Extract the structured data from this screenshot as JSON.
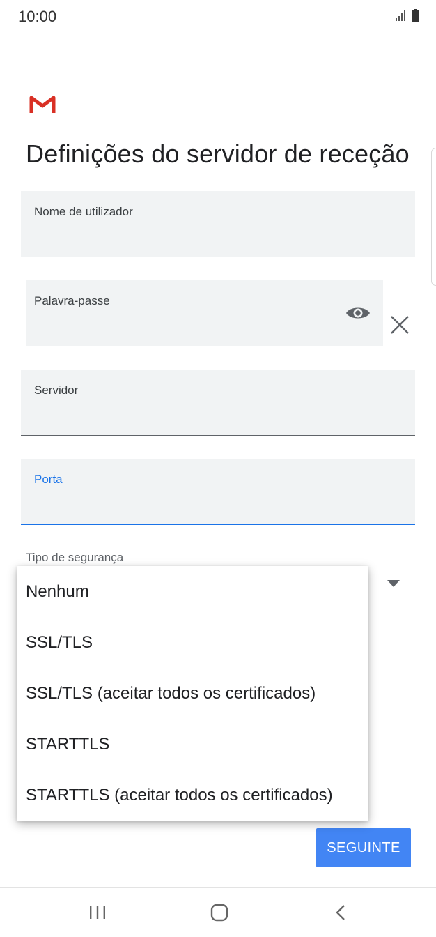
{
  "status_bar": {
    "time": "10:00"
  },
  "header": {
    "title": "Definições do servidor de receção"
  },
  "fields": {
    "username": {
      "label": "Nome de utilizador"
    },
    "password": {
      "label": "Palavra-passe"
    },
    "server": {
      "label": "Servidor"
    },
    "port": {
      "label": "Porta"
    }
  },
  "security": {
    "label": "Tipo de segurança",
    "options": [
      "Nenhum",
      "SSL/TLS",
      "SSL/TLS (aceitar todos os certificados)",
      "STARTTLS",
      "STARTTLS (aceitar todos os certificados)"
    ]
  },
  "actions": {
    "next_label": "SEGUINTE"
  },
  "colors": {
    "accent": "#1a73e8",
    "button": "#4285f4",
    "field_bg": "#f1f3f4"
  },
  "icons": {
    "logo": "gmail-logo",
    "password_toggle": "eye-icon",
    "clear": "close-icon",
    "dropdown": "caret-down-icon",
    "nav_recent": "recent-apps-icon",
    "nav_home": "home-icon",
    "nav_back": "back-icon"
  }
}
